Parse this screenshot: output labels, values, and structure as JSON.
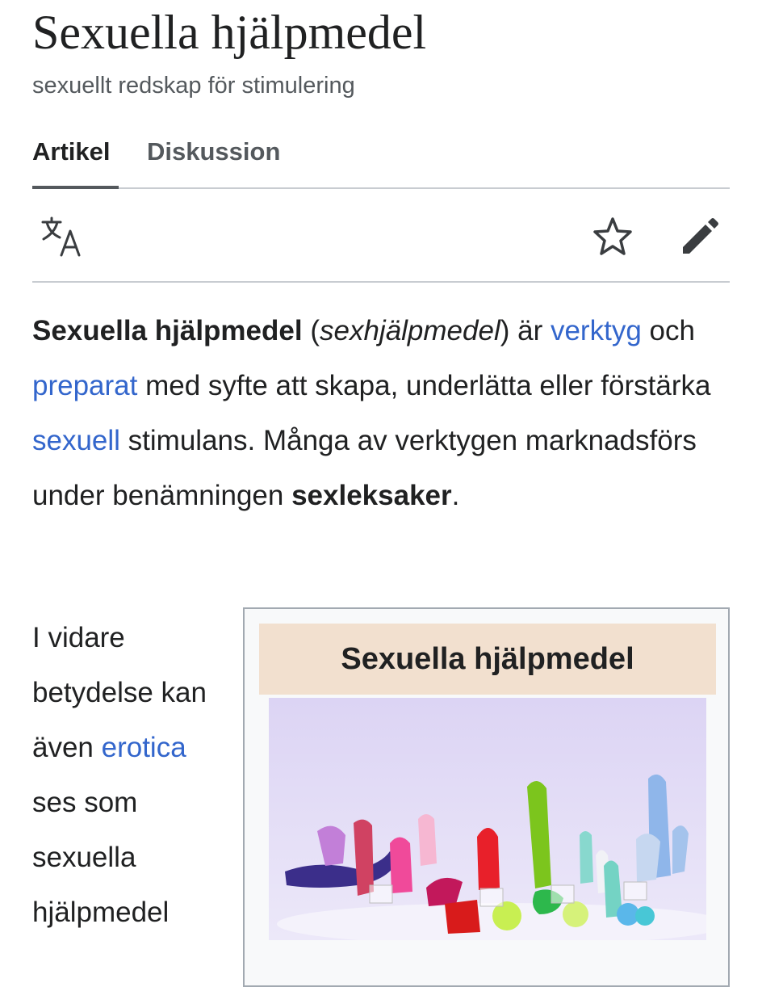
{
  "page": {
    "title": "Sexuella hjälpmedel",
    "subtitle": "sexuellt redskap för stimulering"
  },
  "tabs": [
    {
      "label": "Artikel",
      "active": true
    },
    {
      "label": "Diskussion",
      "active": false
    }
  ],
  "toolbar": {
    "language_icon": "translate-icon",
    "watch_icon": "star-icon",
    "edit_icon": "pencil-icon"
  },
  "lead": {
    "bold_term": "Sexuella hjälpmedel",
    "paren_open": " (",
    "alt_term": "sexhjälpmedel",
    "paren_close": ") är ",
    "link_1": "verktyg",
    "text_1": " och ",
    "link_2": "preparat",
    "text_2": " med syfte att skapa, underlätta eller förstärka ",
    "link_3": "sexuell",
    "text_3": " stimulans. Många av verktygen marknadsförs under benämningen ",
    "bold_term_2": "sexleksaker",
    "text_4": "."
  },
  "second_paragraph": {
    "text_1": "I vidare betydelse kan även ",
    "link_1": "erotica",
    "text_2": " ses som sexuella hjälpmedel"
  },
  "infobox": {
    "title": "Sexuella hjälpmedel",
    "image_icon": "sex-toys-photo"
  },
  "colors": {
    "link": "#3366cc",
    "text": "#202122",
    "muted": "#54595d",
    "divider": "#c8ccd1",
    "infobox_title_bg": "#f2e0cf",
    "infobox_border": "#a2a9b1"
  }
}
